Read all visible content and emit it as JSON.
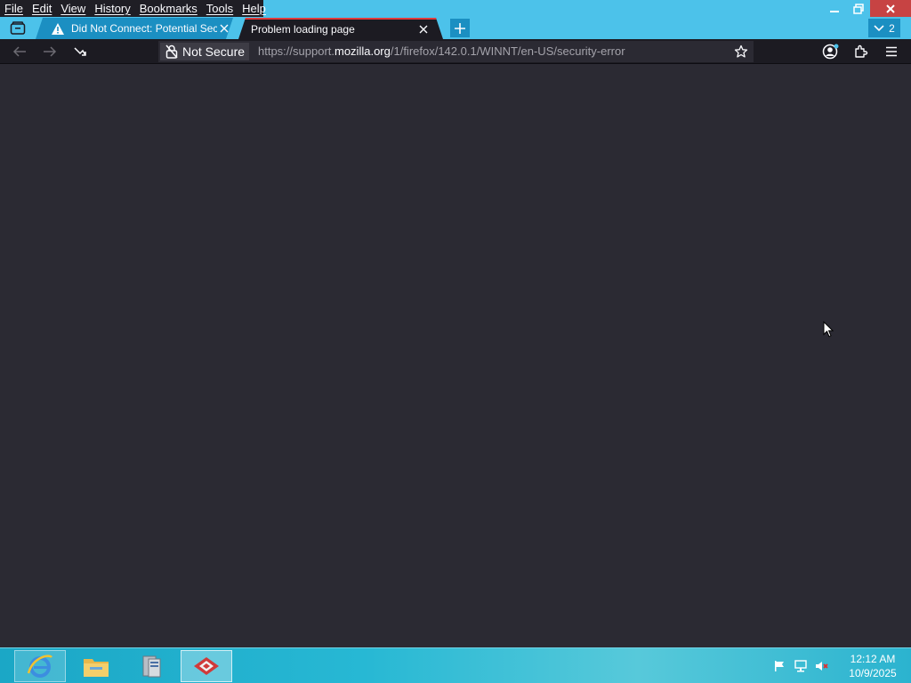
{
  "menubar": {
    "items": [
      {
        "label": "File"
      },
      {
        "label": "Edit"
      },
      {
        "label": "View"
      },
      {
        "label": "History"
      },
      {
        "label": "Bookmarks"
      },
      {
        "label": "Tools"
      },
      {
        "label": "Help"
      }
    ]
  },
  "tabs": [
    {
      "title": "Did Not Connect: Potential Security Issue",
      "icon": "warning-icon",
      "state": "inactive"
    },
    {
      "title": "Problem loading page",
      "icon": "none",
      "state": "active"
    }
  ],
  "tab_list": {
    "count": "2"
  },
  "navbar": {
    "security_label": "Not Secure",
    "url_prefix": "https://support.",
    "url_host": "mozilla.org",
    "url_path": "/1/firefox/142.0.1/WINNT/en-US/security-error"
  },
  "taskbar": {
    "apps": [
      {
        "name": "internet-explorer-icon"
      },
      {
        "name": "file-explorer-icon"
      },
      {
        "name": "server-manager-icon"
      },
      {
        "name": "firefox-app-icon"
      }
    ],
    "tray_icons": [
      "flag-icon",
      "network-icon",
      "speaker-muted-icon"
    ],
    "time": "12:12 AM",
    "date": "10/9/2025"
  },
  "colors": {
    "chrome_accent": "#4cc2ea",
    "page_background": "#2b2a33",
    "toolbar": "#1c1b22",
    "close_button": "#c74343",
    "active_tab_line": "#e03a3a"
  }
}
